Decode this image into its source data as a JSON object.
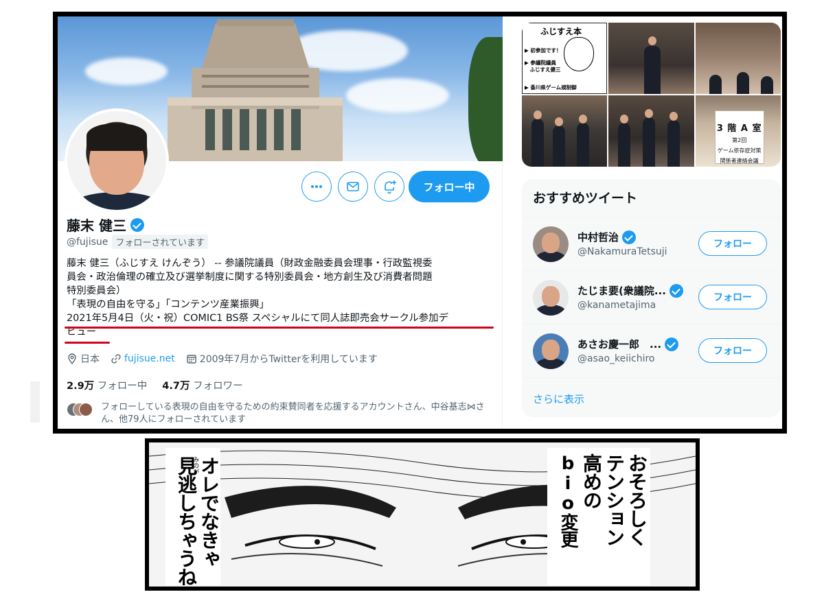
{
  "profile": {
    "display_name": "藤末 健三",
    "handle": "@fujisue",
    "follows_you": "フォローされています",
    "bio_lines": [
      "藤末 健三（ふじすえ けんぞう） -- 参議院議員（財政金融委員会理事・行政監視委",
      "員会・政治倫理の確立及び選挙制度に関する特別委員会・地方創生及び消費者問題",
      "特別委員会）",
      "「表現の自由を守る」「コンテンツ産業振興」",
      "2021年5月4日（火・祝）COMIC1 BS祭 スペシャルにて同人誌即売会サークル参加デ",
      "ビュー"
    ],
    "location": "日本",
    "website": "fujisue.net",
    "joined": "2009年7月からTwitterを利用しています",
    "following_count": "2.9万",
    "following_label": "フォロー中",
    "followers_count": "4.7万",
    "followers_label": "フォロワー",
    "followed_by_text": "フォローしている表現の自由を守るための約束賛同者を応援するアカウントさん、中谷基志⋈さん、他79人にフォローされています",
    "buttons": {
      "more_icon": "more-icon",
      "message_icon": "mail-icon",
      "notify_icon": "bell-plus-icon",
      "follow_label": "フォロー中"
    }
  },
  "photo_grid": {
    "photo1_title": "ふじすえ本",
    "photo1_lines": [
      "▶ 初参加です！",
      "▶ 参議院議員",
      "　ふじすえ健三",
      "▶ 香川県ゲーム規制御"
    ],
    "photo6_lines": [
      "3 階 A 室",
      "第2回",
      "ゲーム依存症対策",
      "関係者連絡会議"
    ]
  },
  "recommend": {
    "title": "おすすめツイート",
    "users": [
      {
        "name": "中村哲治",
        "handle": "@NakamuraTetsuji",
        "verified": true,
        "follow_label": "フォロー"
      },
      {
        "name": "たじま要(衆議院...",
        "handle": "@kanametajima",
        "verified": true,
        "follow_label": "フォロー"
      },
      {
        "name": "あさお慶一郎　...",
        "handle": "@asao_keiichiro",
        "verified": true,
        "follow_label": "フォロー"
      }
    ],
    "show_more": "さらに表示"
  },
  "manga": {
    "left_speech": [
      "オレでなきゃ",
      "見逃しちゃうね"
    ],
    "left_furigana": "みのが",
    "right_speech": [
      "おそろしく",
      "テンション",
      "高めの",
      "bio変更"
    ]
  },
  "colors": {
    "accent": "#1d9bf0",
    "underline": "#d0021b",
    "text_secondary": "#536471"
  }
}
